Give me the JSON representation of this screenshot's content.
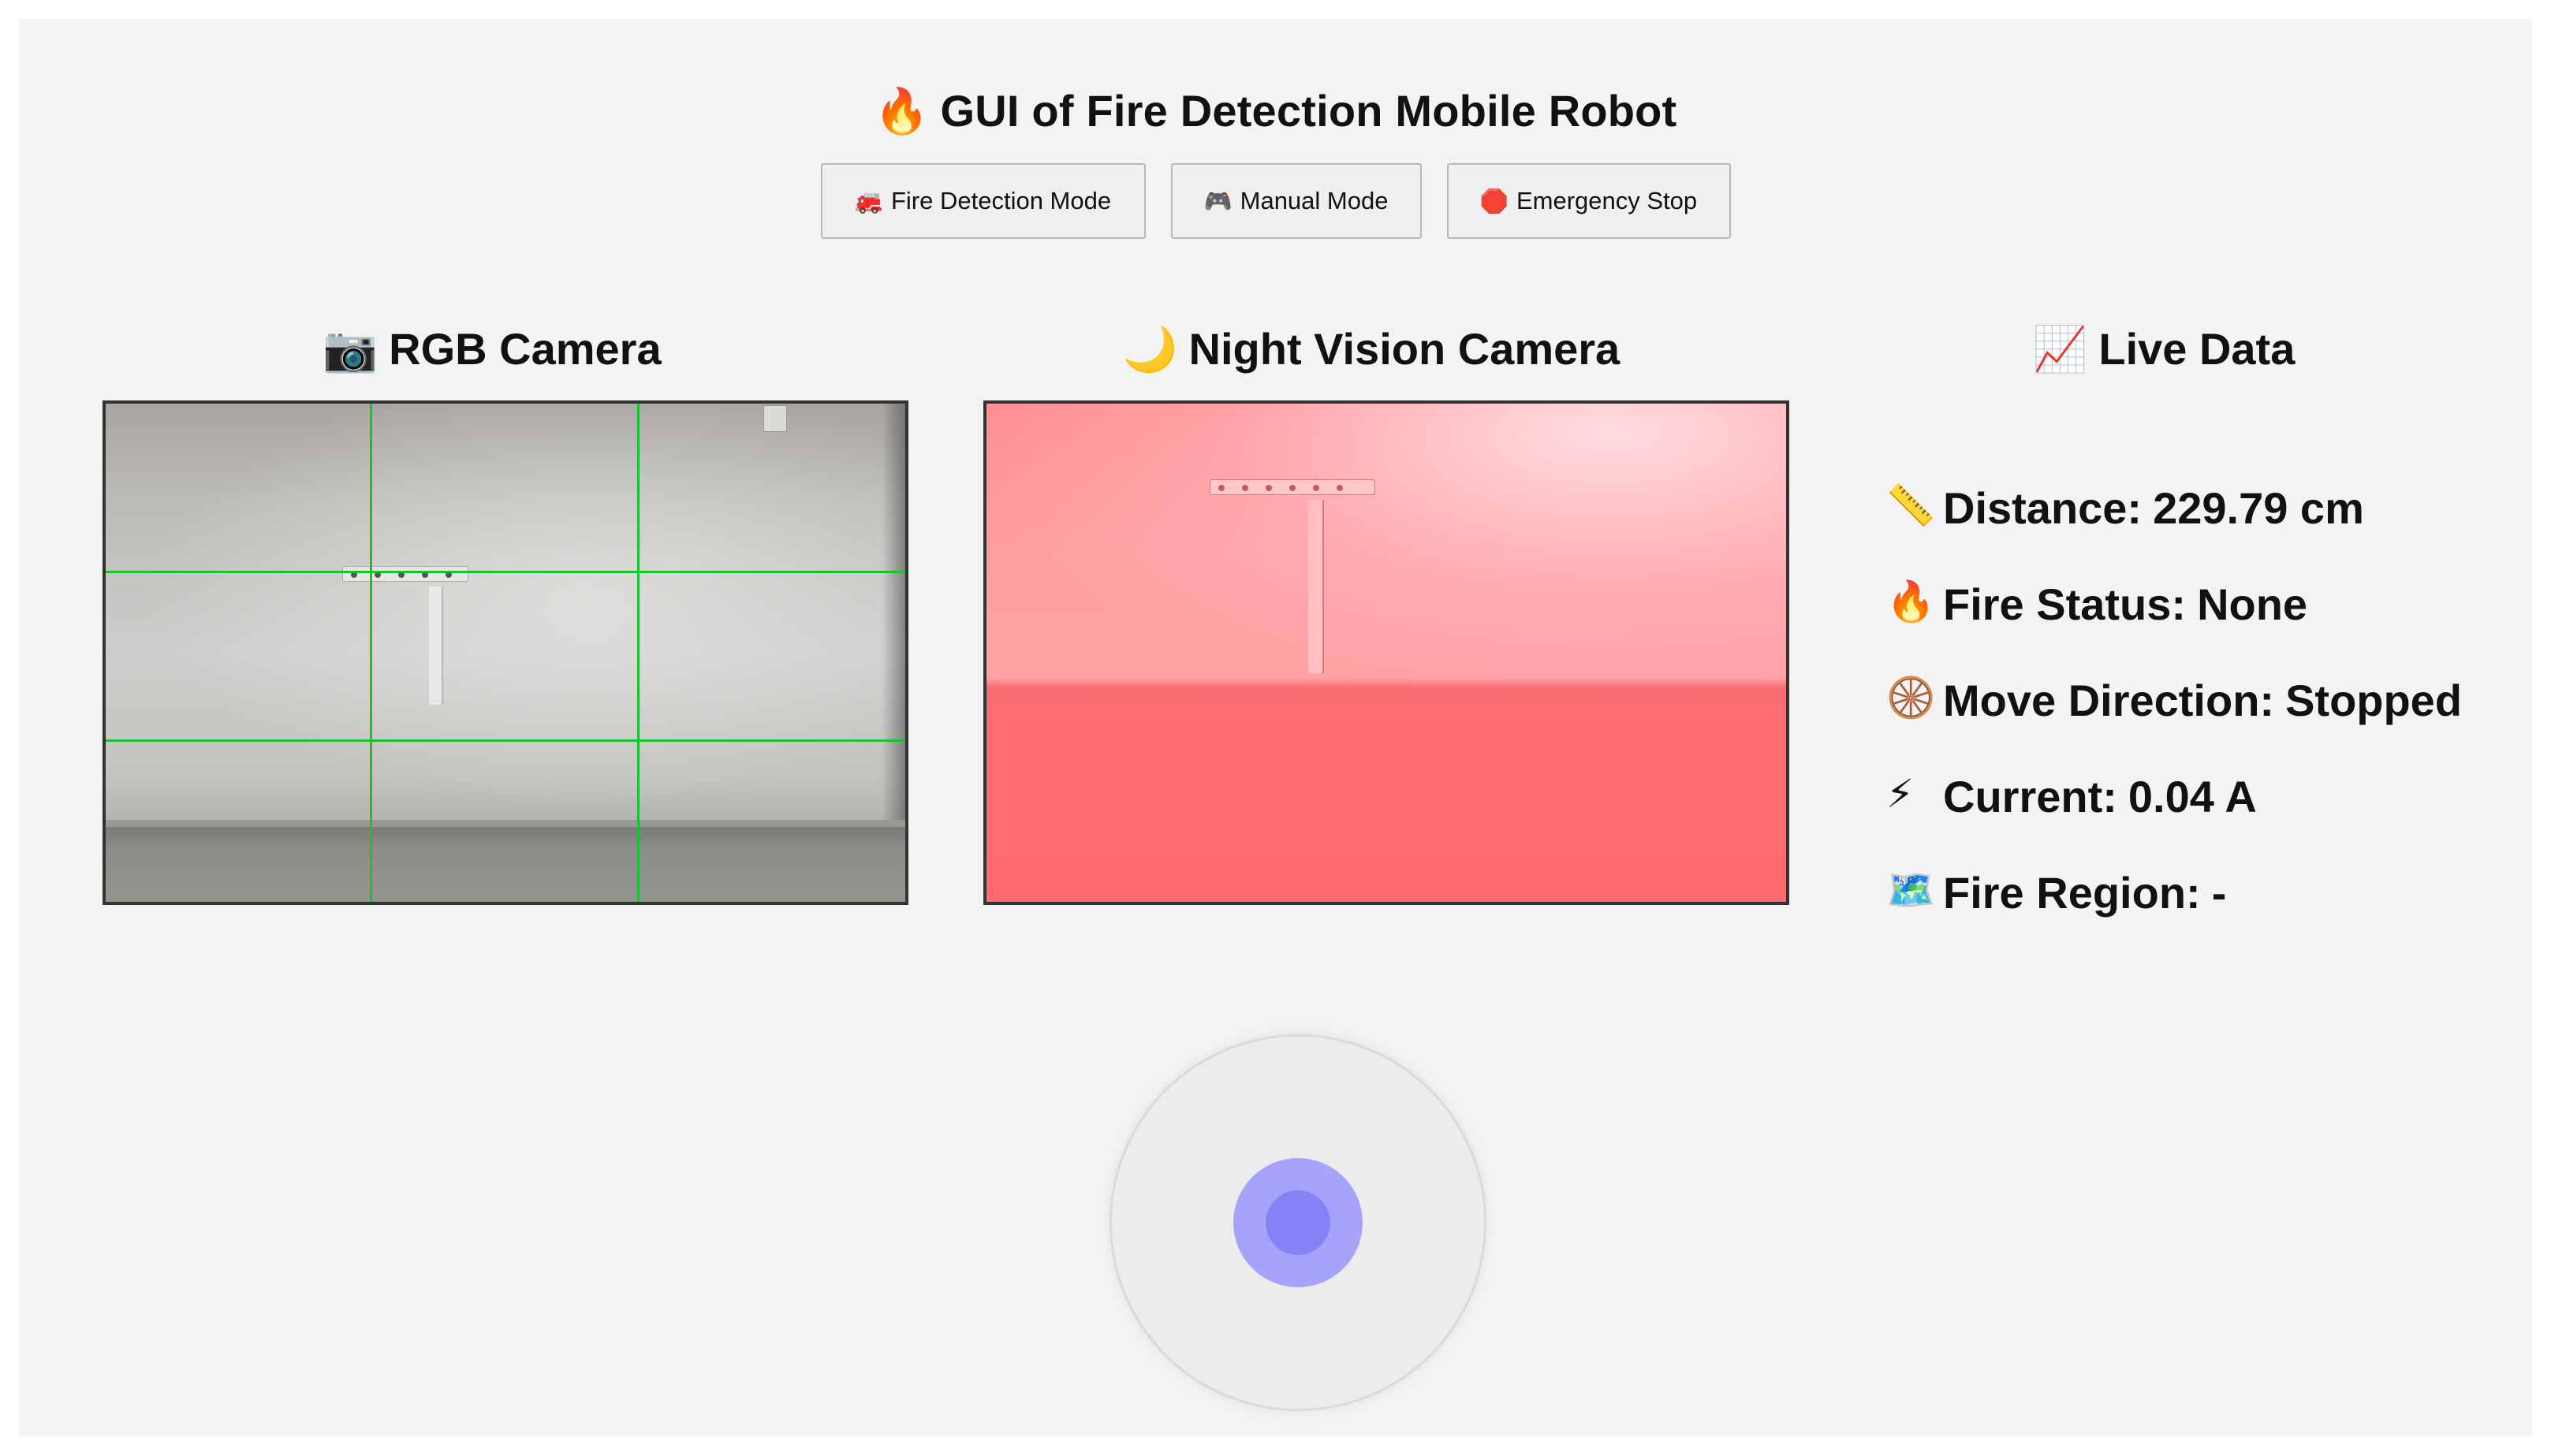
{
  "header": {
    "title_icon": "🔥",
    "title": "GUI of Fire Detection Mobile Robot"
  },
  "mode_buttons": [
    {
      "icon": "🚒",
      "label": "Fire Detection Mode"
    },
    {
      "icon": "🎮",
      "label": "Manual Mode"
    },
    {
      "icon": "🛑",
      "label": "Emergency Stop"
    }
  ],
  "sections": {
    "rgb_camera": {
      "icon": "📷",
      "title": "RGB Camera"
    },
    "night_camera": {
      "icon": "🌙",
      "title": "Night Vision Camera"
    },
    "live_data": {
      "icon": "📈",
      "title": "Live Data"
    }
  },
  "live_data": [
    {
      "icon": "📏",
      "label": "Distance:",
      "value": "229.79 cm"
    },
    {
      "icon": "🔥",
      "label": "Fire Status:",
      "value": "None"
    },
    {
      "icon": "🛞",
      "label": "Move Direction:",
      "value": "Stopped"
    },
    {
      "icon": "⚡",
      "label": "Current:",
      "value": "0.04 A"
    },
    {
      "icon": "🗺️",
      "label": "Fire Region:",
      "value": "-"
    }
  ],
  "colors": {
    "grid_line": "#18c42e",
    "joystick_knob": "#a6a4fa",
    "night_tint": "#ff8d92"
  }
}
